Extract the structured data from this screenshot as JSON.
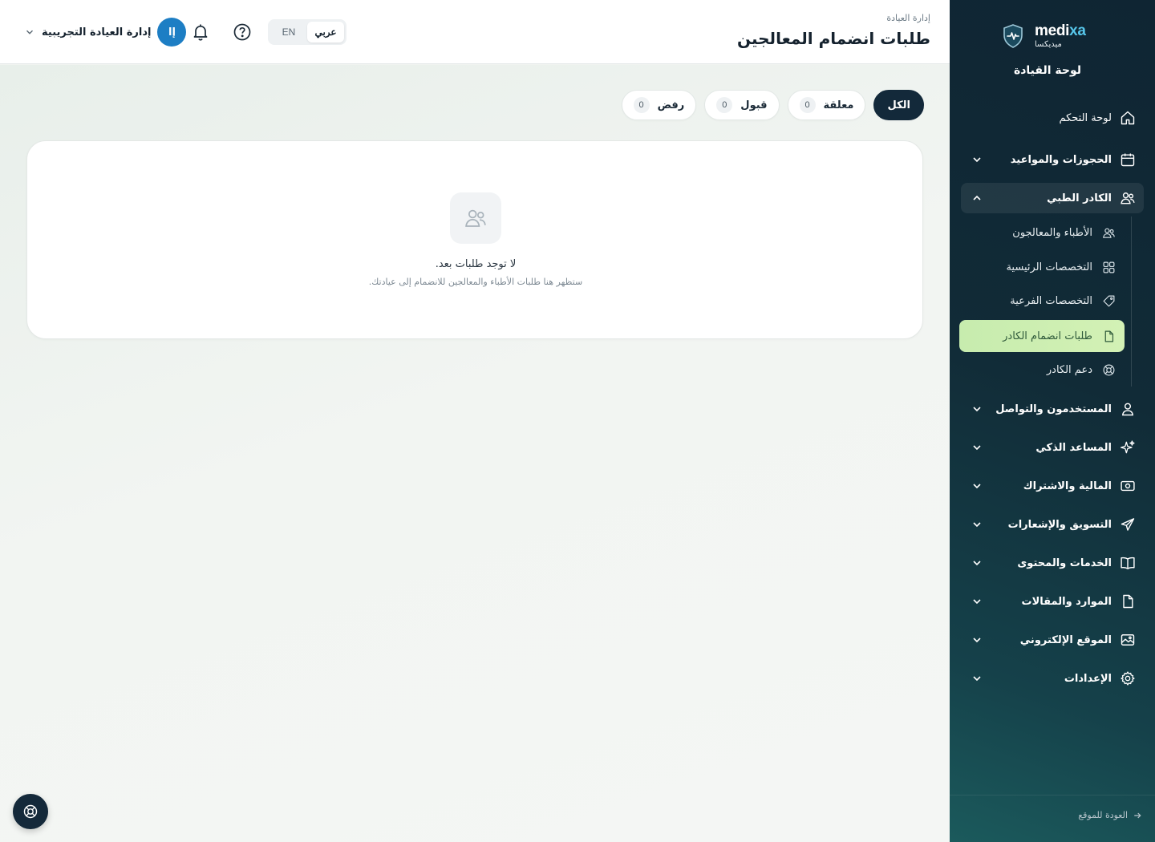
{
  "brand": {
    "latin_prefix": "medi",
    "latin_accent": "xa",
    "arabic": "ميديكسا",
    "accent_color": "#57c6ea"
  },
  "sidebar": {
    "title": "لوحة القيادة",
    "dashboard": {
      "label": "لوحة التحكم",
      "icon": "home-icon"
    },
    "bookings": {
      "label": "الحجوزات والمواعيد",
      "icon": "calendar-icon"
    },
    "medical_staff": {
      "label": "الكادر الطبي",
      "icon": "users-icon",
      "expanded": true
    },
    "staff_sub": {
      "doctors": {
        "label": "الأطباء والمعالجون",
        "icon": "users-icon"
      },
      "main_specialties": {
        "label": "التخصصات الرئيسية",
        "icon": "grid-icon"
      },
      "sub_specialties": {
        "label": "التخصصات الفرعية",
        "icon": "tag-icon"
      },
      "join_requests": {
        "label": "طلبات انضمام الكادر",
        "icon": "file-icon",
        "active": true
      },
      "staff_support": {
        "label": "دعم الكادر",
        "icon": "lifebuoy-icon"
      }
    },
    "users_comm": {
      "label": "المستخدمون والتواصل",
      "icon": "user-icon"
    },
    "ai_assistant": {
      "label": "المساعد الذكي",
      "icon": "sparkles-icon"
    },
    "finance": {
      "label": "المالية والاشتراك",
      "icon": "money-icon"
    },
    "marketing": {
      "label": "التسويق والإشعارات",
      "icon": "send-icon"
    },
    "services": {
      "label": "الخدمات والمحتوى",
      "icon": "book-icon"
    },
    "resources": {
      "label": "الموارد والمقالات",
      "icon": "file-icon"
    },
    "website": {
      "label": "الموقع الإلكتروني",
      "icon": "image-icon"
    },
    "settings": {
      "label": "الإعدادات",
      "icon": "gear-icon"
    },
    "back_link": "العودة للموقع",
    "active_color": "#c7ecae"
  },
  "header": {
    "breadcrumb": "إدارة العيادة",
    "title": "طلبات انضمام المعالجين",
    "lang": {
      "arabic": "عربي",
      "english": "EN",
      "selected": "عربي"
    },
    "user": {
      "initial": "إا",
      "name": "إدارة العيادة التجريبية",
      "avatar_color": "#1d7ec4"
    }
  },
  "filters": {
    "all": {
      "label": "الكل",
      "active": true
    },
    "pending": {
      "label": "معلقة",
      "count": "0"
    },
    "accepted": {
      "label": "قبول",
      "count": "0"
    },
    "rejected": {
      "label": "رفض",
      "count": "0"
    }
  },
  "empty_state": {
    "title": "لا توجد طلبات بعد.",
    "subtitle": "ستظهر هنا طلبات الأطباء والمعالجين للانضمام إلى عيادتك.",
    "icon": "users-icon"
  },
  "fab": {
    "icon": "lifebuoy-icon"
  }
}
